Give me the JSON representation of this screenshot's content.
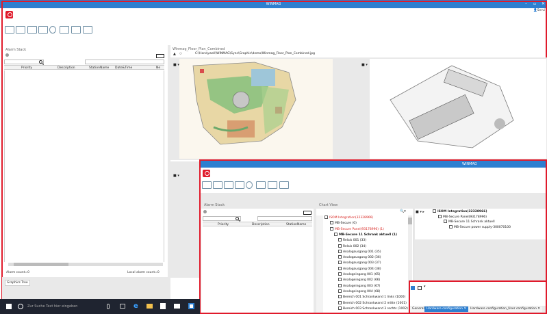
{
  "app": {
    "title": "WINMAG",
    "user": "Servi",
    "inner_title": "WINMAG"
  },
  "colors": {
    "accent": "#2d7fd0",
    "highlight": "#e01a2b",
    "taskbar": "#1f2430"
  },
  "toolbar": {
    "icons": [
      "back-icon",
      "forward-icon",
      "image-icon",
      "grid-icon",
      "user-icon",
      "mute-icon",
      "print-icon",
      "print-preview-icon"
    ]
  },
  "alarm_stack": {
    "title": "Alarm Stack",
    "columns": [
      "Priority",
      "Description",
      "StationName",
      "Date&Time",
      "Ne"
    ],
    "status_left": "Alarm count=0",
    "status_right": "Local alarm count=0"
  },
  "floor_plan": {
    "title": "Winmag_Floor_Plan_Combined",
    "path": "C:\\Honeywell\\WINMAG\\Sync\\Graphic\\demo\\Winmag_Floor_Plan_Combined.jpg"
  },
  "graphics_tree_tab": "Graphics Tree",
  "inner": {
    "alarm_stack": {
      "title": "Alarm Stack",
      "columns": [
        "Priority",
        "Description",
        "StationName"
      ]
    },
    "chart_view": {
      "title": "Chart View",
      "tree": [
        {
          "label": "ISOM Integration(32328966)",
          "red": true
        },
        {
          "label": "MB-Secure (0)",
          "red": false
        },
        {
          "label": "MB-Secure Panel(93178996) (1)",
          "red": true
        },
        {
          "label": "MB-Secure 11 Schrank aktuell (1)",
          "red": false,
          "bold": true
        },
        {
          "label": "Relais 001 (33)",
          "red": false
        },
        {
          "label": "Relais 002 (34)",
          "red": false
        },
        {
          "label": "Analogausgang 001 (35)",
          "red": false
        },
        {
          "label": "Analogausgang 002 (36)",
          "red": false
        },
        {
          "label": "Analogausgang 003 (37)",
          "red": false
        },
        {
          "label": "Analogausgang 004 (38)",
          "red": false
        },
        {
          "label": "Analogeingang 001 (65)",
          "red": false
        },
        {
          "label": "Analogeingang 002 (66)",
          "red": false
        },
        {
          "label": "Analogeingang 003 (67)",
          "red": false
        },
        {
          "label": "Analogeingang 004 (68)",
          "red": false
        },
        {
          "label": "Bereich 001 Schrankwand 1 links (1000)",
          "red": false
        },
        {
          "label": "Bereich 002 Schrankwand 2 mitte (1001)",
          "red": false
        },
        {
          "label": "Bereich 003 Schrankwand 3 rechts (1002)",
          "red": false
        }
      ],
      "right_tree": [
        {
          "label": "ISOM Integration(32328966)",
          "bold": true
        },
        {
          "label": "MB-Secure Panel(93178996)",
          "bold": false
        },
        {
          "label": "MB-Secure 11 Schrank aktuell",
          "bold": false
        },
        {
          "label": "MB-Secure power supply-300070100",
          "bold": false
        }
      ]
    },
    "tabs": [
      "General",
      "Hardware configuration",
      "Hardware configuration_User configuration"
    ]
  },
  "taskbar": {
    "search_placeholder": "Zur Suche Text hier eingeben"
  }
}
